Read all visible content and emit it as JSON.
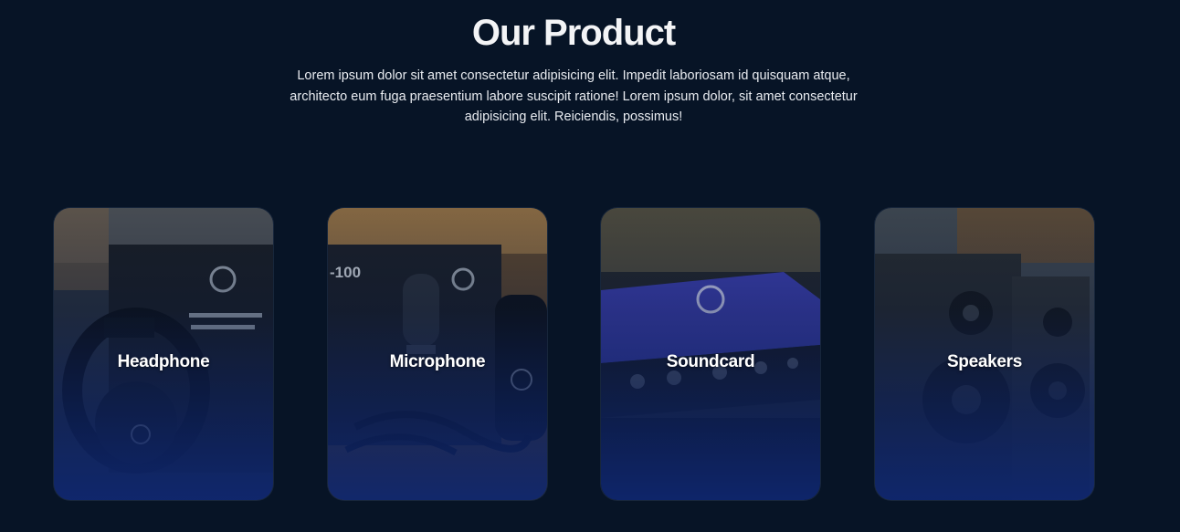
{
  "section": {
    "title": "Our Product",
    "description": "Lorem ipsum dolor sit amet consectetur adipisicing elit. Impedit laboriosam id quisquam atque, architecto eum fuga praesentium labore suscipit ratione! Lorem ipsum dolor, sit amet consectetur adipisicing elit. Reiciendis, possimus!"
  },
  "products": [
    {
      "label": "Headphone",
      "icon": "headphone-photo"
    },
    {
      "label": "Microphone",
      "icon": "microphone-photo"
    },
    {
      "label": "Soundcard",
      "icon": "soundcard-photo"
    },
    {
      "label": "Speakers",
      "icon": "speakers-photo"
    }
  ],
  "colors": {
    "background": "#071426",
    "card_gradient_bottom": "#0e266e",
    "soundcard_body": "#3b3fb0",
    "text": "#ffffff"
  }
}
